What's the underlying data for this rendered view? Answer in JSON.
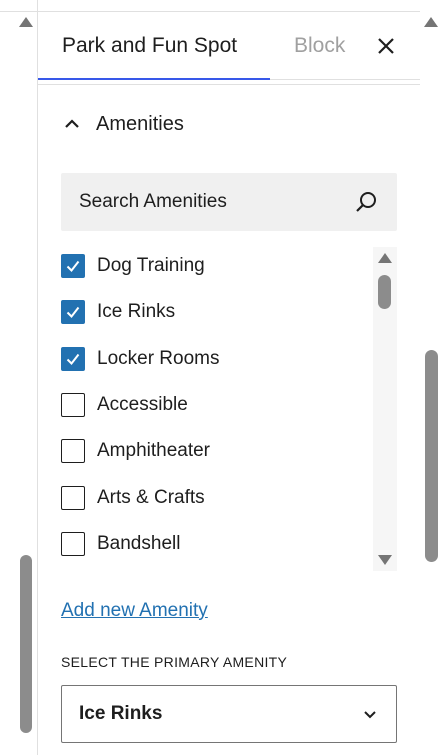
{
  "tabs": {
    "active_label": "Park and Fun Spot",
    "inactive_label": "Block"
  },
  "panel": {
    "title": "Amenities"
  },
  "search": {
    "placeholder": "Search Amenities"
  },
  "amenities": [
    {
      "label": "Dog Training",
      "checked": true
    },
    {
      "label": "Ice Rinks",
      "checked": true
    },
    {
      "label": "Locker Rooms",
      "checked": true
    },
    {
      "label": "Accessible",
      "checked": false
    },
    {
      "label": "Amphitheater",
      "checked": false
    },
    {
      "label": "Arts & Crafts",
      "checked": false
    },
    {
      "label": "Bandshell",
      "checked": false
    }
  ],
  "add_new": {
    "label": "Add new Amenity"
  },
  "primary": {
    "label": "SELECT THE PRIMARY AMENITY",
    "selected": "Ice Rinks"
  },
  "colors": {
    "accent": "#3858e9",
    "checkbox": "#2271b1",
    "link": "#2271b1"
  },
  "icons": {
    "close": "close-icon",
    "collapse": "chevron-up-icon",
    "search": "search-icon",
    "check": "checkmark-icon",
    "select": "chevron-down-icon"
  }
}
